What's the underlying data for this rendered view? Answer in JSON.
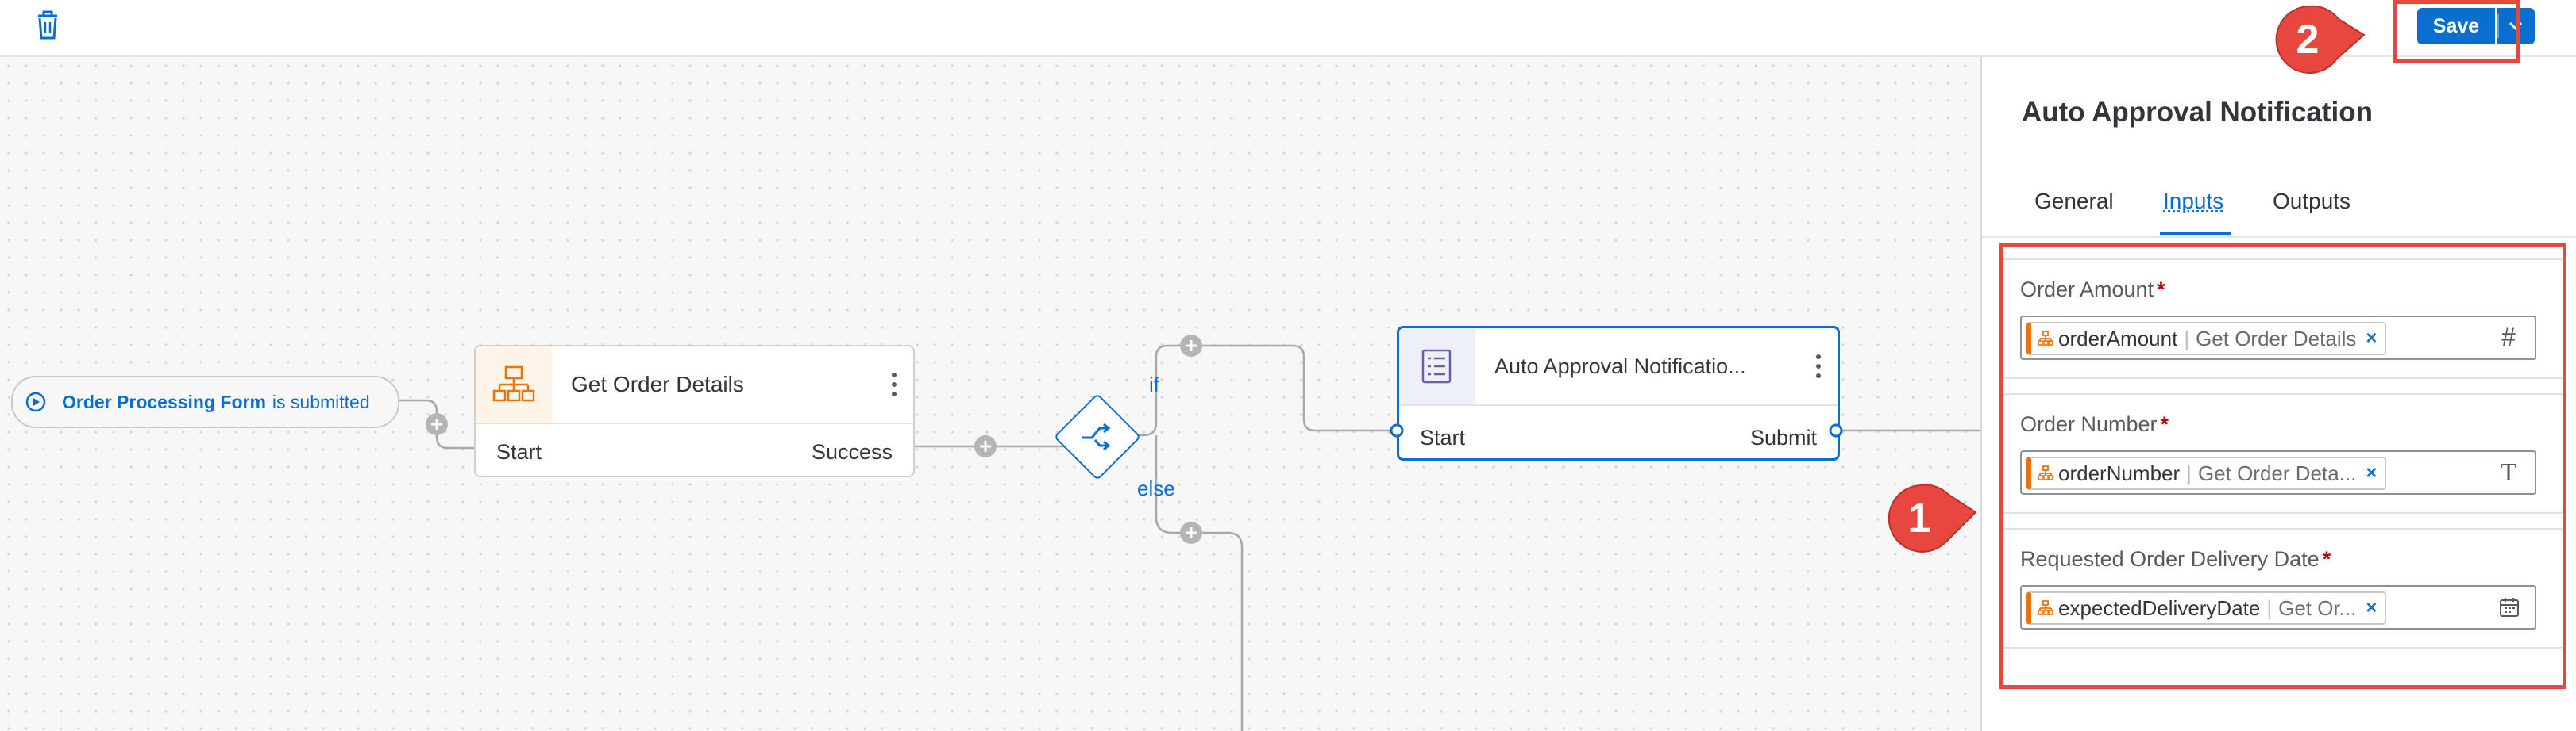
{
  "toolbar": {
    "delete_icon": "trash-icon",
    "save_label": "Save",
    "save_dropdown_icon": "chevron-down-icon"
  },
  "canvas": {
    "trigger": {
      "form_name": "Order Processing Form",
      "suffix": "is submitted"
    },
    "nodes": [
      {
        "title": "Get Order Details",
        "left_port": "Start",
        "right_port": "Success",
        "icon": "hierarchy-icon"
      },
      {
        "title": "Auto Approval Notificatio...",
        "left_port": "Start",
        "right_port": "Submit",
        "icon": "form-icon"
      }
    ],
    "branch": {
      "if_label": "if",
      "else_label": "else"
    }
  },
  "panel": {
    "title": "Auto Approval Notification",
    "tabs": [
      {
        "label": "General"
      },
      {
        "label": "Inputs",
        "active": true
      },
      {
        "label": "Outputs"
      }
    ],
    "fields": [
      {
        "label": "Order Amount",
        "required": "*",
        "token_name": "orderAmount",
        "token_source": "Get Order Details",
        "type_glyph": "#"
      },
      {
        "label": "Order Number",
        "required": "*",
        "token_name": "orderNumber",
        "token_source": "Get Order Deta...",
        "type_glyph": "T"
      },
      {
        "label": "Requested Order Delivery Date",
        "required": "*",
        "token_name": "expectedDeliveryDate",
        "token_source": "Get Or...",
        "type_glyph": "calendar-icon"
      }
    ],
    "token_remove": "×"
  },
  "callouts": [
    {
      "number": "1"
    },
    {
      "number": "2"
    }
  ],
  "colors": {
    "accent": "#0a6ed1",
    "highlight": "#e8473f",
    "token_bar": "#e9730c",
    "required": "#bb0000"
  }
}
